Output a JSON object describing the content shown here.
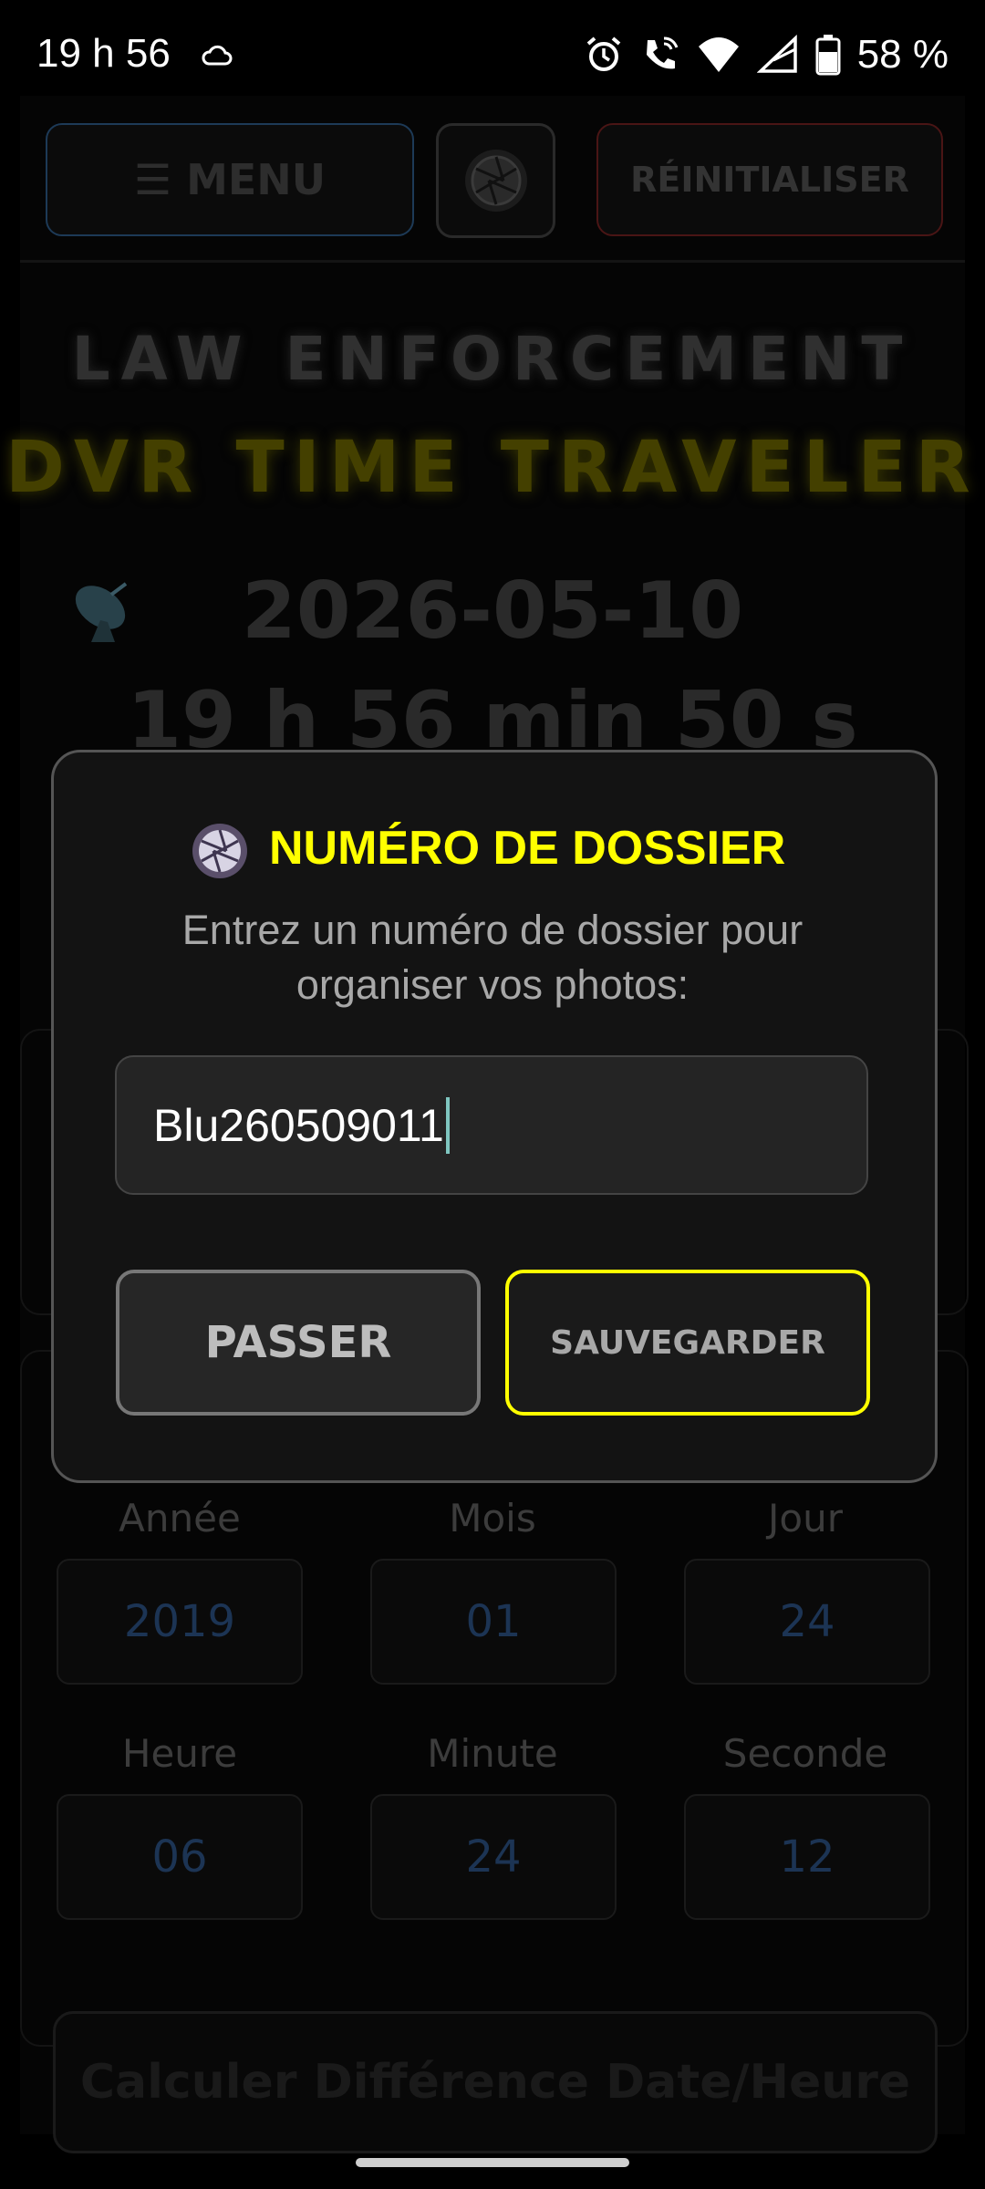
{
  "status_bar": {
    "time": "19 h 56",
    "battery": "58 %",
    "icons": [
      "cloud-icon",
      "alarm-icon",
      "wifi-call-icon",
      "wifi-icon",
      "signal-icon",
      "battery-icon"
    ]
  },
  "topbar": {
    "menu_label": "☰ MENU",
    "reset_label": "RÉINITIALISER"
  },
  "header": {
    "line1": "LAW ENFORCEMENT",
    "line2": "DVR TIME TRAVELER",
    "date": "2026-05-10",
    "time": "19 h 56 min 50 s"
  },
  "fields": {
    "year": {
      "label": "Année",
      "value": "2019"
    },
    "month": {
      "label": "Mois",
      "value": "01"
    },
    "day": {
      "label": "Jour",
      "value": "24"
    },
    "hour": {
      "label": "Heure",
      "value": "06"
    },
    "minute": {
      "label": "Minute",
      "value": "24"
    },
    "second": {
      "label": "Seconde",
      "value": "12"
    }
  },
  "calc_button": "Calculer Différence Date/Heure",
  "modal": {
    "title": "NUMÉRO DE DOSSIER",
    "description": "Entrez un numéro de dossier pour organiser vos photos:",
    "input_value": "Blu260509011",
    "skip_label": "PASSER",
    "save_label": "SAUVEGARDER"
  },
  "colors": {
    "accent_yellow": "#ffff00",
    "modal_bg": "#131313"
  }
}
